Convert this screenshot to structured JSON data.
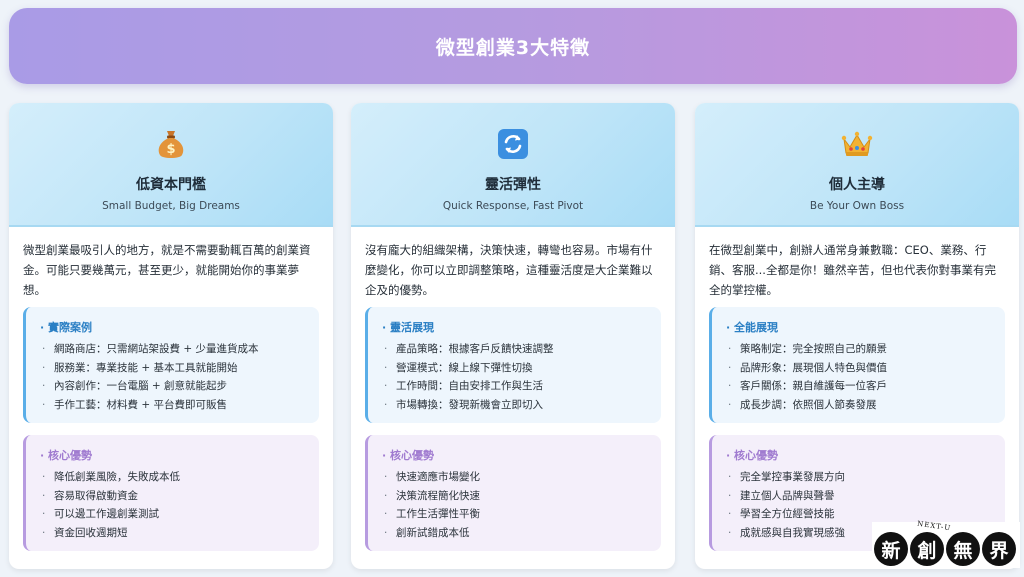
{
  "banner": {
    "title": "微型創業3大特徵"
  },
  "colors": {
    "banner_start": "#a99be6",
    "banner_end": "#c992da",
    "accent_blue": "#2a7fc4",
    "accent_purple": "#a07bd0"
  },
  "cards": [
    {
      "icon": "money-bag-icon",
      "title": "低資本門檻",
      "subtitle": "Small Budget, Big Dreams",
      "description": "微型創業最吸引人的地方，就是不需要動輒百萬的創業資金。可能只要幾萬元，甚至更少，就能開始你的事業夢想。",
      "box1": {
        "title": "· 實際案例",
        "items": [
          "網路商店：只需網站架設費 + 少量進貨成本",
          "服務業：專業技能 + 基本工具就能開始",
          "內容創作：一台電腦 + 創意就能起步",
          "手作工藝：材料費 + 平台費即可販售"
        ]
      },
      "box2": {
        "title": "· 核心優勢",
        "items": [
          "降低創業風險，失敗成本低",
          "容易取得啟動資金",
          "可以邊工作邊創業測試",
          "資金回收週期短"
        ]
      }
    },
    {
      "icon": "refresh-icon",
      "title": "靈活彈性",
      "subtitle": "Quick Response, Fast Pivot",
      "description": "沒有龐大的組織架構，決策快速，轉彎也容易。市場有什麼變化，你可以立即調整策略，這種靈活度是大企業難以企及的優勢。",
      "box1": {
        "title": "· 靈活展現",
        "items": [
          "產品策略：根據客戶反饋快速調整",
          "營運模式：線上線下彈性切換",
          "工作時間：自由安排工作與生活",
          "市場轉換：發現新機會立即切入"
        ]
      },
      "box2": {
        "title": "· 核心優勢",
        "items": [
          "快速適應市場變化",
          "決策流程簡化快速",
          "工作生活彈性平衡",
          "創新試錯成本低"
        ]
      }
    },
    {
      "icon": "crown-icon",
      "title": "個人主導",
      "subtitle": "Be Your Own Boss",
      "description": "在微型創業中，創辦人通常身兼數職：CEO、業務、行銷、客服...全都是你！雖然辛苦，但也代表你對事業有完全的掌控權。",
      "box1": {
        "title": "· 全能展現",
        "items": [
          "策略制定：完全按照自己的願景",
          "品牌形象：展現個人特色與價值",
          "客戶關係：親自維護每一位客戶",
          "成長步調：依照個人節奏發展"
        ]
      },
      "box2": {
        "title": "· 核心優勢",
        "items": [
          "完全掌控事業發展方向",
          "建立個人品牌與聲譽",
          "學習全方位經營技能",
          "成就感與自我實現感強"
        ]
      }
    }
  ],
  "logo": {
    "arc_text": "NEXT-U",
    "chars": [
      "新",
      "創",
      "無",
      "界"
    ]
  }
}
